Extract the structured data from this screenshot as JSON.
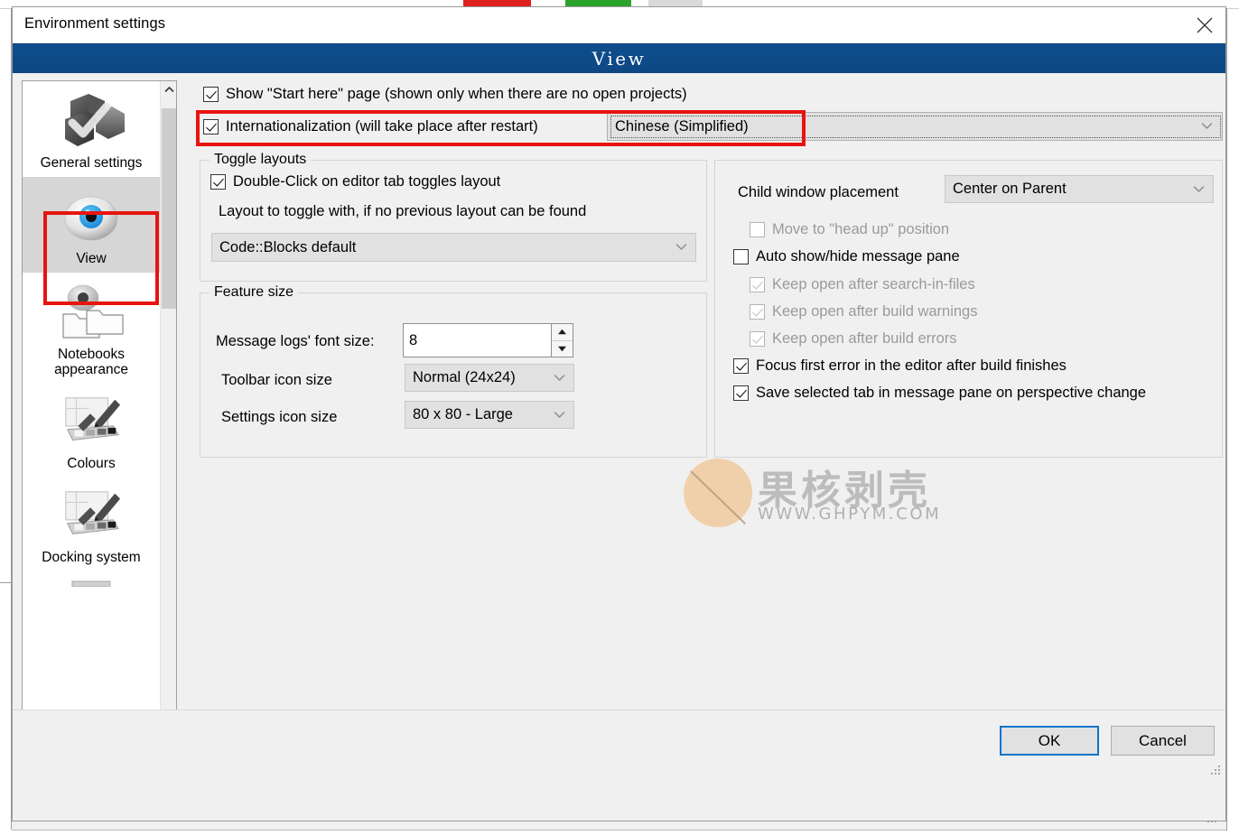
{
  "window": {
    "title": "Environment settings",
    "close_icon": "close-icon",
    "banner_title": "View"
  },
  "sidebar": {
    "items": [
      {
        "label": "General settings",
        "icon": "general-settings-icon",
        "selected": false
      },
      {
        "label": "View",
        "icon": "eye-icon",
        "selected": true
      },
      {
        "label": "Notebooks\nappearance",
        "icon": "notebooks-appearance-icon",
        "selected": false
      },
      {
        "label": "Colours",
        "icon": "colours-palette-icon",
        "selected": false
      },
      {
        "label": "Docking system",
        "icon": "docking-system-icon",
        "selected": false
      }
    ],
    "scroll_up_icon": "chevron-up-icon",
    "scroll_down_icon": "chevron-down-icon"
  },
  "main": {
    "show_start_here": {
      "label": "Show \"Start here\" page (shown only when there are no open projects)",
      "checked": true
    },
    "internationalization": {
      "label": "Internationalization (will take place after restart)",
      "checked": true,
      "language_value": "Chinese (Simplified)",
      "arrow_icon": "chevron-down-icon"
    },
    "toggle_layouts": {
      "title": "Toggle layouts",
      "double_click": {
        "label": "Double-Click on editor tab toggles layout",
        "checked": true
      },
      "hint": "Layout to toggle with, if no previous layout can be found",
      "layout_value": "Code::Blocks default",
      "arrow_icon": "chevron-down-icon"
    },
    "feature_size": {
      "title": "Feature size",
      "message_logs_label": "Message logs' font size:",
      "message_logs_value": "8",
      "spin_up_icon": "triangle-up-icon",
      "spin_down_icon": "triangle-down-icon",
      "toolbar_icon_label": "Toolbar icon size",
      "toolbar_icon_value": "Normal (24x24)",
      "settings_icon_label": "Settings icon size",
      "settings_icon_value": "80 x 80 - Large",
      "arrow_icon": "chevron-down-icon"
    },
    "right_panel": {
      "child_window_label": "Child window placement",
      "child_window_value": "Center on Parent",
      "arrow_icon": "chevron-down-icon",
      "checkboxes": [
        {
          "label": "Move to \"head up\" position",
          "checked": false,
          "disabled": true
        },
        {
          "label": "Auto show/hide message pane",
          "checked": false,
          "disabled": false
        },
        {
          "label": "Keep open after search-in-files",
          "checked": true,
          "disabled": true
        },
        {
          "label": "Keep open after build warnings",
          "checked": true,
          "disabled": true
        },
        {
          "label": "Keep open after build errors",
          "checked": true,
          "disabled": true
        },
        {
          "label": "Focus first error in the editor after build finishes",
          "checked": true,
          "disabled": false
        },
        {
          "label": "Save selected tab in message pane on perspective change",
          "checked": true,
          "disabled": false
        }
      ]
    }
  },
  "footer": {
    "ok_label": "OK",
    "cancel_label": "Cancel",
    "resize_grip_icon": "resize-grip-icon"
  },
  "watermark": {
    "text_cn": "果核剥壳",
    "url": "WWW.GHPYM.COM",
    "badge_icon": "no-entry-icon"
  },
  "colors": {
    "banner_blue": "#0d4c8b",
    "highlight_red": "#e8140f",
    "focus_blue": "#0a74c8",
    "dialog_bg": "#f0f0f0",
    "selected_item_bg": "#d6d6d6"
  }
}
